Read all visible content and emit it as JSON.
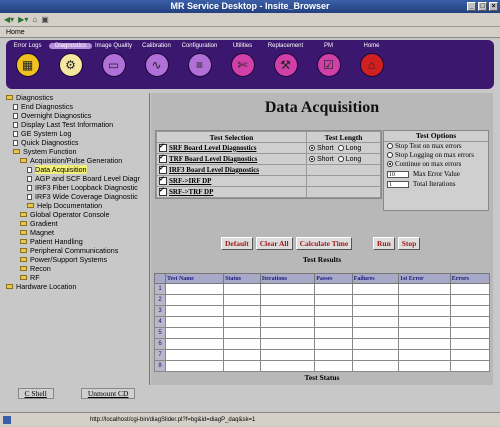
{
  "window": {
    "title": "MR Service Desktop - Insite_Browser"
  },
  "bookmarks": {
    "home_label": "Home"
  },
  "toolbar": {
    "items": [
      {
        "label": "Error Logs",
        "icon": "grid-icon",
        "color": "#f0c020",
        "selected": false
      },
      {
        "label": "Diagnostics",
        "icon": "gears-icon",
        "color": "#f5e6a0",
        "selected": true
      },
      {
        "label": "Image Quality",
        "icon": "monitor-icon",
        "color": "#b070d8",
        "selected": false
      },
      {
        "label": "Calibration",
        "icon": "wave-icon",
        "color": "#b070d8",
        "selected": false
      },
      {
        "label": "Configuration",
        "icon": "config-icon",
        "color": "#b070d8",
        "selected": false
      },
      {
        "label": "Utilities",
        "icon": "tools-icon",
        "color": "#d040a8",
        "selected": false
      },
      {
        "label": "Replacement",
        "icon": "wrench-icon",
        "color": "#d040a8",
        "selected": false
      },
      {
        "label": "PM",
        "icon": "checklist-icon",
        "color": "#d040a8",
        "selected": false
      },
      {
        "label": "Home",
        "icon": "home-icon",
        "color": "#d02020",
        "selected": false
      }
    ]
  },
  "sidebar": {
    "items": [
      {
        "label": "Diagnostics",
        "type": "folder",
        "indent": 0
      },
      {
        "label": "End Diagnostics",
        "type": "doc",
        "indent": 1
      },
      {
        "label": "Overnight Diagnostics",
        "type": "doc",
        "indent": 1
      },
      {
        "label": "Display Last Test Information",
        "type": "doc",
        "indent": 1
      },
      {
        "label": "GE System Log",
        "type": "doc",
        "indent": 1
      },
      {
        "label": "Quick Diagnostics",
        "type": "doc",
        "indent": 1
      },
      {
        "label": "System Function",
        "type": "folder",
        "indent": 1
      },
      {
        "label": "Acquisition/Pulse Generation",
        "type": "folder",
        "indent": 2
      },
      {
        "label": "Data Acquisition",
        "type": "doc",
        "indent": 3,
        "selected": true
      },
      {
        "label": "AGP and SCF Board Level Diagr",
        "type": "doc",
        "indent": 3
      },
      {
        "label": "IRF3 Fiber Loopback Diagnostic",
        "type": "doc",
        "indent": 3
      },
      {
        "label": "IRF3 Wide Coverage Diagnostic",
        "type": "doc",
        "indent": 3
      },
      {
        "label": "Help Documentation",
        "type": "folder",
        "indent": 3
      },
      {
        "label": "Global Operator Console",
        "type": "folder",
        "indent": 2
      },
      {
        "label": "Gradient",
        "type": "folder",
        "indent": 2
      },
      {
        "label": "Magnet",
        "type": "folder",
        "indent": 2
      },
      {
        "label": "Patient Handling",
        "type": "folder",
        "indent": 2
      },
      {
        "label": "Peripheral Communications",
        "type": "folder",
        "indent": 2
      },
      {
        "label": "Power/Support Systems",
        "type": "folder",
        "indent": 2
      },
      {
        "label": "Recon",
        "type": "folder",
        "indent": 2
      },
      {
        "label": "RF",
        "type": "folder",
        "indent": 2
      },
      {
        "label": "Hardware Location",
        "type": "folder",
        "indent": 0
      }
    ]
  },
  "main": {
    "title": "Data Acquisition",
    "test_selection_header": "Test Selection",
    "test_length_header": "Test Length",
    "tests": [
      {
        "name": "SRF Board Level Diagnostics",
        "checked": true,
        "length": "Short"
      },
      {
        "name": "TRF Board Level Diagnostics",
        "checked": true,
        "length": "Short"
      },
      {
        "name": "IRF3 Board Level Diagnostics",
        "checked": true,
        "length": null
      },
      {
        "name": "SRF->IRF DP",
        "checked": true,
        "length": null
      },
      {
        "name": "SRF->TRF DP",
        "checked": true,
        "length": null
      }
    ],
    "length_short": "Short",
    "length_long": "Long",
    "options": {
      "header": "Test Options",
      "stop_on_max": "Stop Test on max errors",
      "stop_logging": "Stop Logging on max errors",
      "continue": "Continue on max errors",
      "max_error_value": "10",
      "max_error_label": "Max Error Value",
      "total_iterations_value": "1",
      "total_iterations_label": "Total Iterations"
    },
    "buttons": {
      "default": "Default",
      "clear_all": "Clear All",
      "calculate_time": "Calculate Time",
      "run": "Run",
      "stop": "Stop"
    },
    "results_title": "Test Results",
    "results_columns": [
      "Test Name",
      "Status",
      "Iterations",
      "Passes",
      "Failures",
      "1st Error",
      "Errors"
    ],
    "results_rows": [
      "1",
      "2",
      "3",
      "4",
      "5",
      "6",
      "7",
      "8"
    ],
    "status_title": "Test Status"
  },
  "bottom": {
    "cshell": "C Shell",
    "unmount": "Unmount CD"
  },
  "statusbar": {
    "url": "http://localhost/cgi-bin/diagSlider.pl?f=bg&id=diagP_daq&sk=1"
  }
}
